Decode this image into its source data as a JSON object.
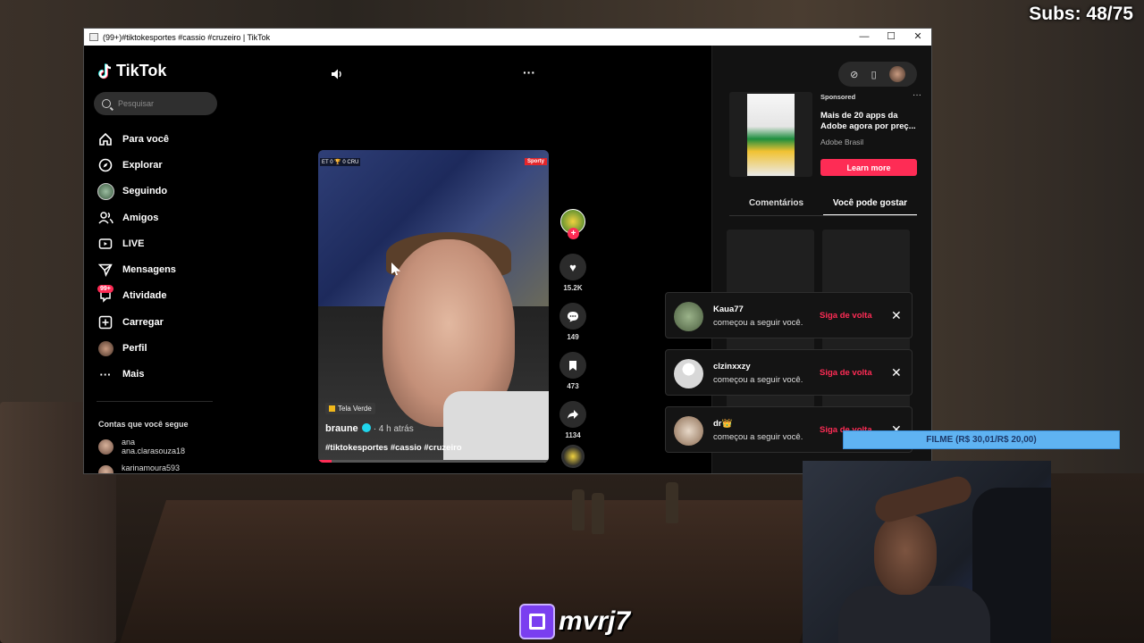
{
  "overlay": {
    "subs": "Subs: 48/75",
    "donation_bar": "FILME (R$ 30,01/R$ 20,00)",
    "twitch_name": "mvrj7"
  },
  "window": {
    "title": "(99+)#tiktokesportes #cassio #cruzeiro | TikTok",
    "minimize": "—",
    "maximize": "☐",
    "close": "✕"
  },
  "sidebar": {
    "logo": "TikTok",
    "search_placeholder": "Pesquisar",
    "nav": [
      {
        "label": "Para você",
        "icon": "home-icon"
      },
      {
        "label": "Explorar",
        "icon": "compass-icon"
      },
      {
        "label": "Seguindo",
        "icon": "following-avatar-icon"
      },
      {
        "label": "Amigos",
        "icon": "friends-icon"
      },
      {
        "label": "LIVE",
        "icon": "live-icon"
      },
      {
        "label": "Mensagens",
        "icon": "messages-icon"
      },
      {
        "label": "Atividade",
        "icon": "activity-icon",
        "badge": "99+"
      },
      {
        "label": "Carregar",
        "icon": "upload-icon"
      },
      {
        "label": "Perfil",
        "icon": "profile-icon"
      },
      {
        "label": "Mais",
        "icon": "more-icon"
      }
    ],
    "following_title": "Contas que você segue",
    "following": [
      {
        "name": "ana",
        "handle": "ana.clarasouza18"
      },
      {
        "name": "karinamoura593",
        "handle": "karinamoura593"
      }
    ]
  },
  "video": {
    "score": "ET 0 🏆 0 CRU",
    "brand_tag": "Sporty",
    "sticker": "Tela Verde",
    "author": "braune",
    "time": "· 4 h atrás",
    "caption": "#tiktokesportes #cassio #cruzeiro",
    "progress": 0.06
  },
  "actions": {
    "likes": "15.2K",
    "comments": "149",
    "saves": "473",
    "shares": "1134"
  },
  "right": {
    "sponsored": "Sponsored",
    "ad_title": "Mais de 20 apps da Adobe agora por preç...",
    "ad_brand": "Adobe Brasil",
    "learn_more": "Learn more",
    "tabs": [
      "Comentários",
      "Você pode gostar"
    ]
  },
  "notifications": [
    {
      "user": "Kaua77",
      "text": "começou a seguir você.",
      "action": "Siga de volta"
    },
    {
      "user": "clzinxxzy",
      "text": "começou a seguir você.",
      "action": "Siga de volta"
    },
    {
      "user": "dr👑",
      "text": "começou a seguir você.",
      "action": "Siga de volta"
    }
  ],
  "colors": {
    "accent": "#fe2c55",
    "donation": "#5fb3f2",
    "twitch": "#7a3ff0"
  }
}
